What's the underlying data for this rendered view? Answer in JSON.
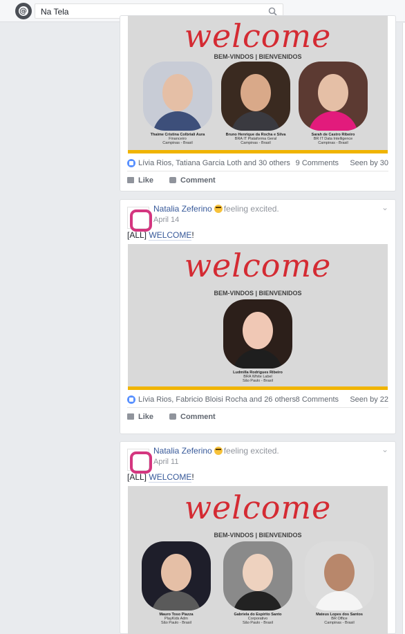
{
  "search": {
    "value": "Na Tela"
  },
  "colors": {
    "accent": "#365899",
    "welcome": "#d42b33",
    "bar": "#f0b400"
  },
  "posts": [
    {
      "image": {
        "welcome": "welcome",
        "subtitle": "BEM-VINDOS | BIENVENIDOS",
        "people": [
          {
            "name": "Thaime Cristina Colbriali Aura",
            "role": "Financeiro",
            "location": "Campinas - Brasil"
          },
          {
            "name": "Bruno Henrique da Rocha e Silva",
            "role": "BRA IT Plataforma Geral",
            "location": "Campinas - Brasil"
          },
          {
            "name": "Sarah de Castro Ribeiro",
            "role": "BR IT Data Intelligence",
            "location": "Campinas - Brasil"
          }
        ]
      },
      "likers": "Lívia Rios, Tatiana Garcia Loth and 30 others",
      "comments": "9 Comments",
      "seen": "Seen by 30",
      "like_label": "Like",
      "comment_label": "Comment"
    },
    {
      "author": "Natalia Zeferino",
      "feeling": "feeling excited.",
      "date": "April 14",
      "text_prefix": "[ALL]",
      "text_link": "WELCOME",
      "text_suffix": "!",
      "image": {
        "welcome": "welcome",
        "subtitle": "BEM-VINDOS | BIENVENIDOS",
        "people": [
          {
            "name": "Ludmilla Rodrigues Ribeiro",
            "role": "BRA White Label",
            "location": "São Paulo - Brasil"
          }
        ]
      },
      "likers": "Lívia Rios, Fabricio Bloisi Rocha and 26 others",
      "comments": "8 Comments",
      "seen": "Seen by 22",
      "like_label": "Like",
      "comment_label": "Comment"
    },
    {
      "author": "Natalia Zeferino",
      "feeling": "feeling excited.",
      "date": "April 11",
      "text_prefix": "[ALL]",
      "text_link": "WELCOME",
      "text_suffix": "!",
      "image": {
        "welcome": "welcome",
        "subtitle": "BEM-VINDOS | BIENVENIDOS",
        "people": [
          {
            "name": "Mauro Toso Piazza",
            "role": "PlayKids Adm",
            "location": "São Paulo - Brasil"
          },
          {
            "name": "Gabriela do Espírito Santo",
            "role": "Corporativo",
            "location": "São Paulo - Brasil"
          },
          {
            "name": "Mateus Lopes dos Santos",
            "role": "BR Office",
            "location": "Campinas - Brasil"
          }
        ]
      }
    }
  ]
}
